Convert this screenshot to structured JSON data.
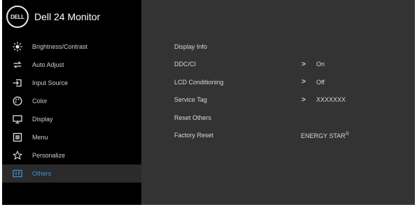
{
  "header": {
    "logo": "DELL",
    "title": "Dell 24 Monitor"
  },
  "sidebar": {
    "items": [
      {
        "label": "Brightness/Contrast",
        "icon": "brightness-icon"
      },
      {
        "label": "Auto Adjust",
        "icon": "auto-adjust-icon"
      },
      {
        "label": "Input Source",
        "icon": "input-source-icon"
      },
      {
        "label": "Color",
        "icon": "color-palette-icon"
      },
      {
        "label": "Display",
        "icon": "display-icon"
      },
      {
        "label": "Menu",
        "icon": "menu-icon"
      },
      {
        "label": "Personalize",
        "icon": "star-icon"
      },
      {
        "label": "Others",
        "icon": "others-icon",
        "active": true
      }
    ]
  },
  "others": {
    "display_info": "Display Info",
    "ddc_ci": {
      "label": "DDC/CI",
      "value": "On"
    },
    "lcd_conditioning": {
      "label": "LCD Conditioning",
      "value": "Off"
    },
    "service_tag": {
      "label": "Service Tag",
      "value": "XXXXXXX"
    },
    "reset_others": "Reset Others",
    "factory_reset": {
      "label": "Factory Reset",
      "energy_star": "ENERGY STAR",
      "registered": "®"
    },
    "chevron": ">"
  },
  "colors": {
    "accent": "#3f8fd8",
    "sidebar_bg": "#000000",
    "panel_bg": "#333333"
  }
}
